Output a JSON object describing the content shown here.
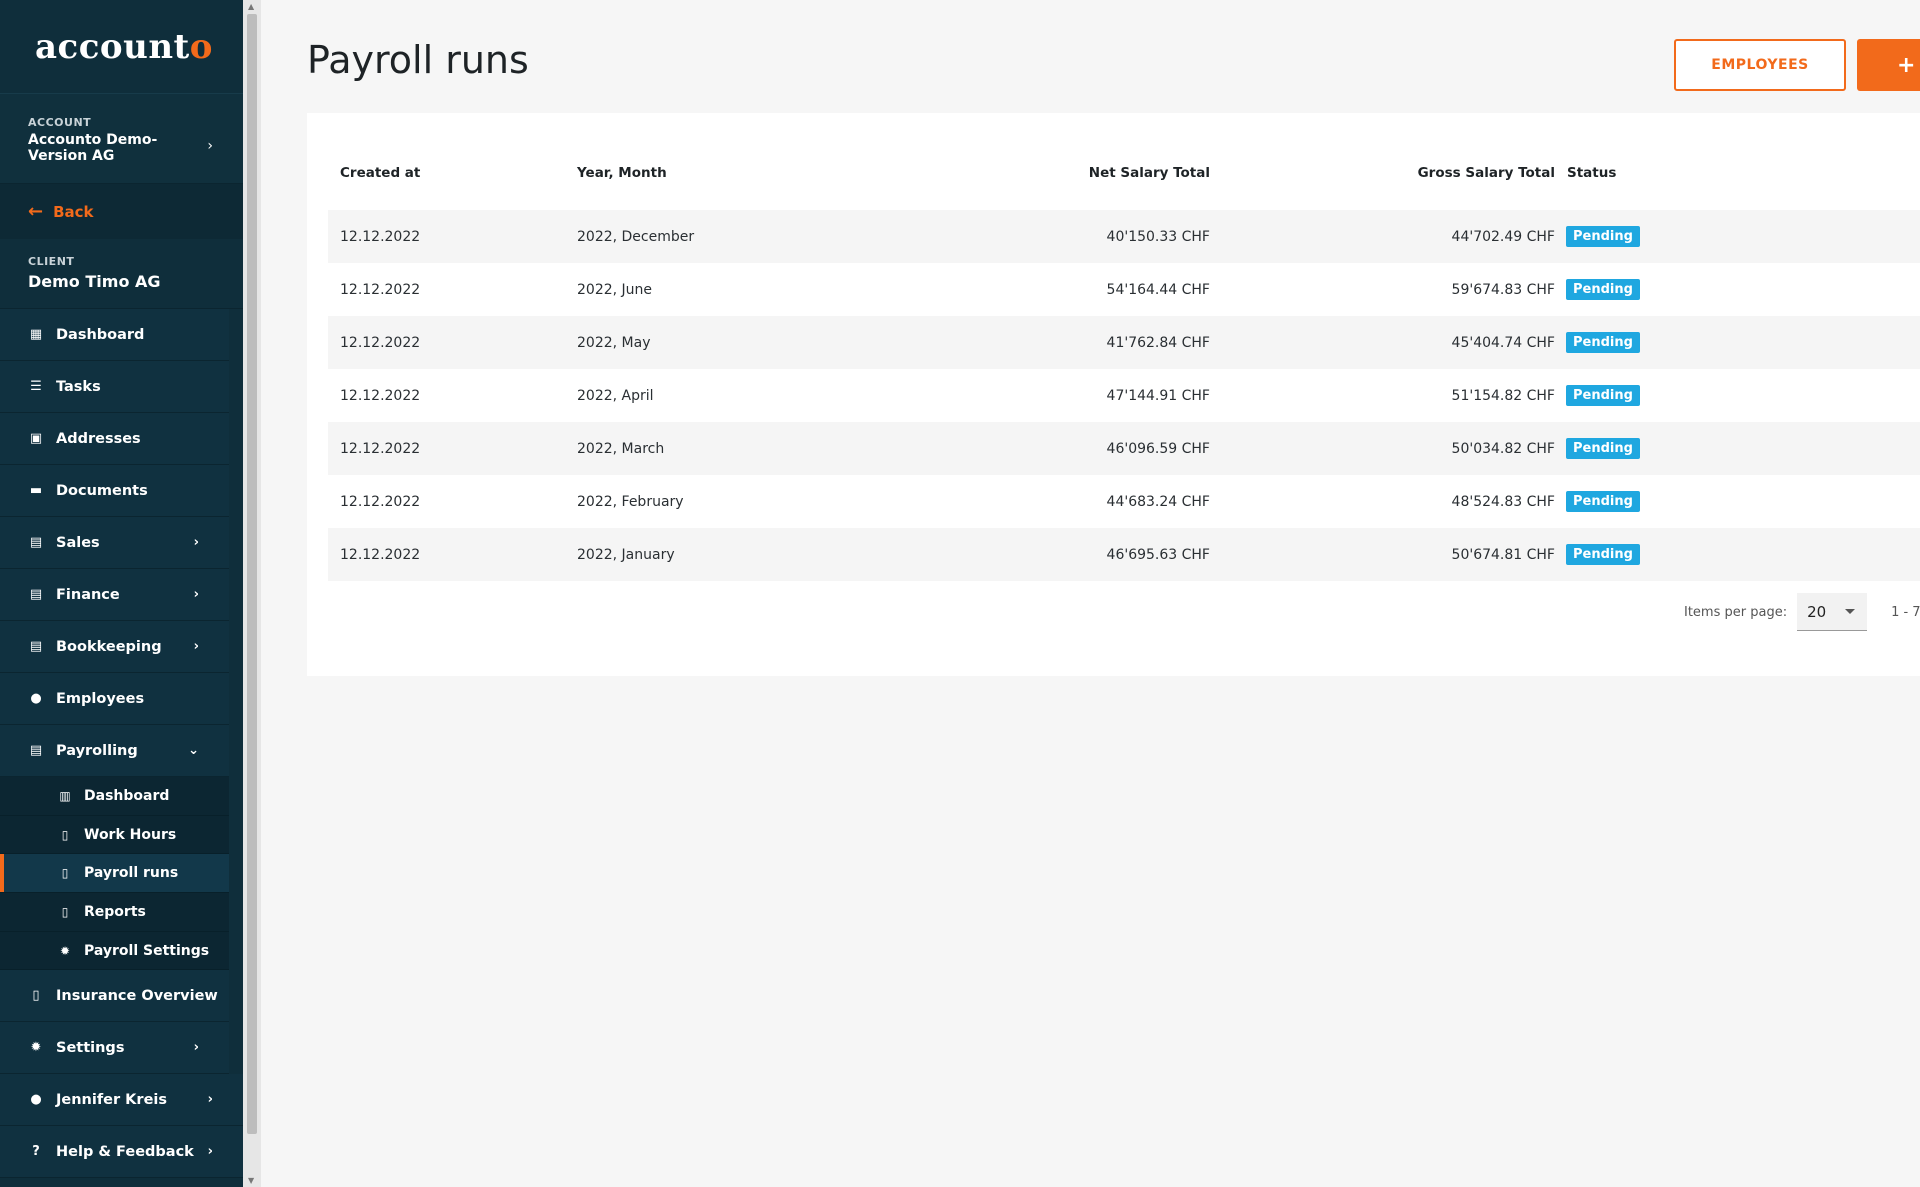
{
  "brand": {
    "logo_main": "account",
    "logo_accent": "o"
  },
  "account": {
    "label": "ACCOUNT",
    "name": "Accounto Demo-Version AG"
  },
  "back_label": "Back",
  "client": {
    "label": "CLIENT",
    "name": "Demo Timo AG"
  },
  "nav": {
    "dashboard": "Dashboard",
    "tasks": "Tasks",
    "addresses": "Addresses",
    "documents": "Documents",
    "sales": "Sales",
    "finance": "Finance",
    "bookkeeping": "Bookkeeping",
    "employees": "Employees",
    "payrolling": "Payrolling",
    "payrolling_sub": {
      "dashboard": "Dashboard",
      "work_hours": "Work Hours",
      "payroll_runs": "Payroll runs",
      "reports": "Reports",
      "payroll_settings": "Payroll Settings"
    },
    "insurance_overview": "Insurance Overview",
    "settings": "Settings",
    "user": "Jennifer Kreis",
    "help": "Help & Feedback"
  },
  "page": {
    "title": "Payroll runs",
    "employees_button": "EMPLOYEES",
    "add_button": "+"
  },
  "table": {
    "headers": [
      "Created at",
      "Year, Month",
      "Net Salary Total",
      "Gross Salary Total",
      "Status"
    ],
    "rows": [
      [
        "12.12.2022",
        "2022, December",
        "40'150.33 CHF",
        "44'702.49 CHF",
        "Pending"
      ],
      [
        "12.12.2022",
        "2022, June",
        "54'164.44 CHF",
        "59'674.83 CHF",
        "Pending"
      ],
      [
        "12.12.2022",
        "2022, May",
        "41'762.84 CHF",
        "45'404.74 CHF",
        "Pending"
      ],
      [
        "12.12.2022",
        "2022, April",
        "47'144.91 CHF",
        "51'154.82 CHF",
        "Pending"
      ],
      [
        "12.12.2022",
        "2022, March",
        "46'096.59 CHF",
        "50'034.82 CHF",
        "Pending"
      ],
      [
        "12.12.2022",
        "2022, February",
        "44'683.24 CHF",
        "48'524.83 CHF",
        "Pending"
      ],
      [
        "12.12.2022",
        "2022, January",
        "46'695.63 CHF",
        "50'674.81 CHF",
        "Pending"
      ]
    ]
  },
  "pager": {
    "label": "Items per page:",
    "value": "20",
    "range": "1 - 7"
  },
  "colors": {
    "accent": "#f26a1b",
    "sidebar": "#0f2e3b",
    "status_pending": "#1fa7e0"
  }
}
